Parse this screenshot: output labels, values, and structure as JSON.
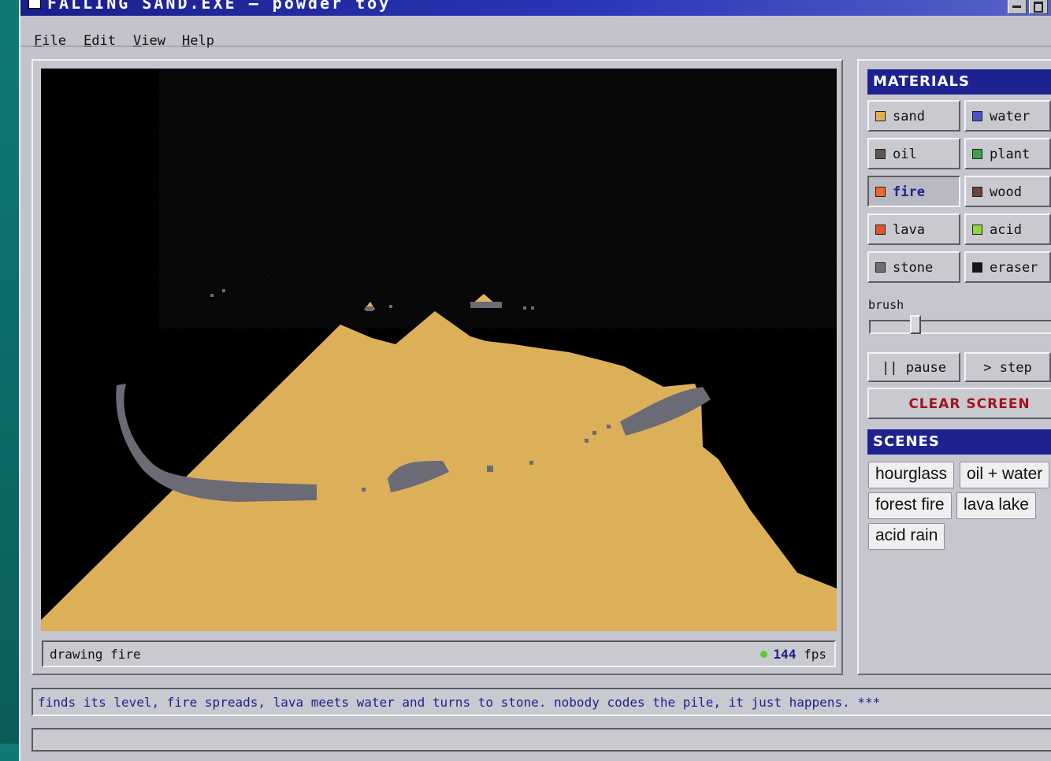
{
  "window": {
    "title": "FALLING SAND.EXE — powder toy"
  },
  "menu": [
    {
      "key": "F",
      "rest": "ile"
    },
    {
      "key": "E",
      "rest": "dit"
    },
    {
      "key": "V",
      "rest": "iew"
    },
    {
      "key": "H",
      "rest": "elp"
    }
  ],
  "status": {
    "text": "drawing fire",
    "fps_value": "144",
    "fps_unit": "fps"
  },
  "materials": {
    "heading": "MATERIALS",
    "selected": "fire",
    "items": [
      {
        "label": "sand",
        "color": "#e3b04d"
      },
      {
        "label": "water",
        "color": "#4a52c8"
      },
      {
        "label": "oil",
        "color": "#5e544c"
      },
      {
        "label": "plant",
        "color": "#3fa14d"
      },
      {
        "label": "fire",
        "color": "#ec6a24"
      },
      {
        "label": "wood",
        "color": "#6e4438"
      },
      {
        "label": "lava",
        "color": "#e0552a"
      },
      {
        "label": "acid",
        "color": "#8fd63a"
      },
      {
        "label": "stone",
        "color": "#6f6f78"
      },
      {
        "label": "eraser",
        "color": "#15151c"
      }
    ]
  },
  "brush": {
    "label": "brush",
    "value_fraction": 0.22
  },
  "controls": {
    "pause_label": "|| pause",
    "step_label": "> step",
    "clear_label": "CLEAR SCREEN"
  },
  "scenes": {
    "heading": "SCENES",
    "items": [
      "hourglass",
      "oil + water",
      "forest fire",
      "lava lake",
      "acid rain"
    ]
  },
  "ticker": {
    "text": "finds its level, fire spreads, lava meets water and turns to stone. nobody codes the pile, it just happens. ***"
  }
}
